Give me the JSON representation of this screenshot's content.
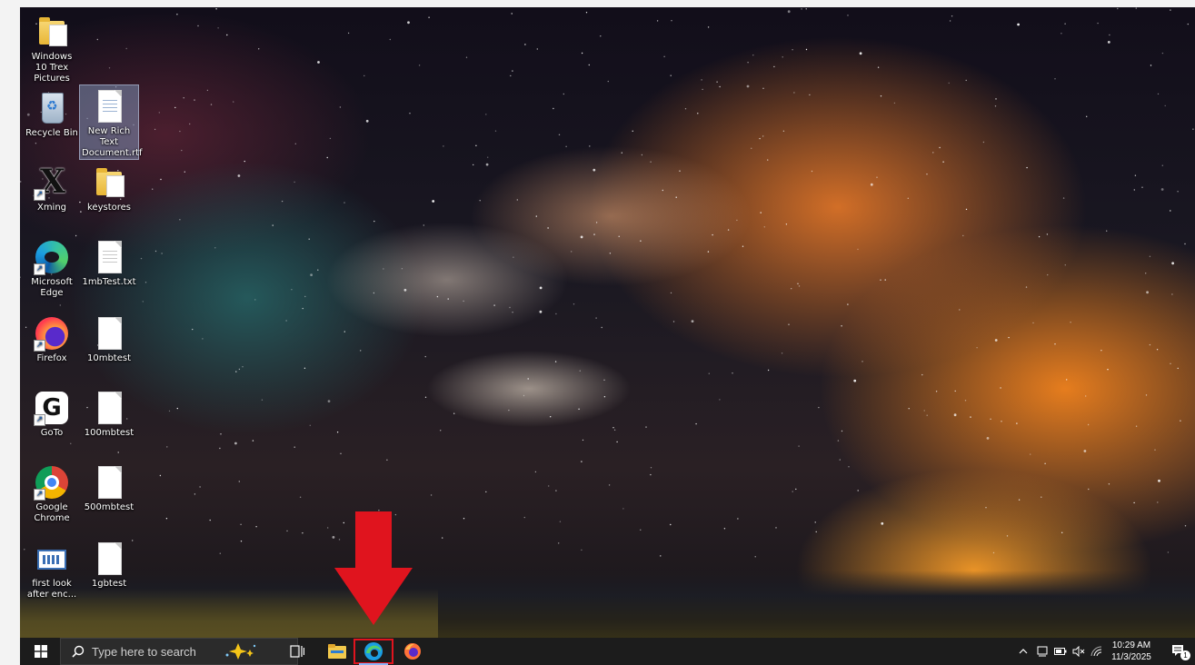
{
  "desktop": {
    "icons": [
      {
        "id": "windows-10-trex-pictures",
        "label": "Windows 10 Trex Pictures",
        "icon": "folder-icon"
      },
      {
        "id": "recycle-bin",
        "label": "Recycle Bin",
        "icon": "recycle-bin-icon"
      },
      {
        "id": "new-rich-text-document",
        "label": "New Rich Text Document.rtf",
        "icon": "rtf-document-icon"
      },
      {
        "id": "xming",
        "label": "Xming",
        "icon": "xming-icon"
      },
      {
        "id": "keystores",
        "label": "keystores",
        "icon": "folder-icon"
      },
      {
        "id": "microsoft-edge",
        "label": "Microsoft Edge",
        "icon": "edge-icon"
      },
      {
        "id": "1mbtest",
        "label": "1mbTest.txt",
        "icon": "text-file-icon"
      },
      {
        "id": "firefox",
        "label": "Firefox",
        "icon": "firefox-icon"
      },
      {
        "id": "10mbtest",
        "label": "10mbtest",
        "icon": "blank-file-icon"
      },
      {
        "id": "goto",
        "label": "GoTo",
        "icon": "goto-icon"
      },
      {
        "id": "100mbtest",
        "label": "100mbtest",
        "icon": "blank-file-icon"
      },
      {
        "id": "google-chrome",
        "label": "Google Chrome",
        "icon": "chrome-icon"
      },
      {
        "id": "500mbtest",
        "label": "500mbtest",
        "icon": "blank-file-icon"
      },
      {
        "id": "first-look",
        "label": "first look after enc...",
        "icon": "screenshot-icon"
      },
      {
        "id": "1gbtest",
        "label": "1gbtest",
        "icon": "blank-file-icon"
      }
    ]
  },
  "annotation": {
    "type": "red-arrow",
    "color": "#e0141e",
    "target": "taskbar edge button"
  },
  "taskbar": {
    "search_placeholder": "Type here to search",
    "pinned": [
      "start-icon",
      "search-icon",
      "copilot-icon",
      "task-view-icon",
      "file-explorer-icon",
      "edge-icon",
      "firefox-icon"
    ],
    "highlighted_app": "edge",
    "tray_icons": [
      "chevron-up-icon",
      "meet-now-icon",
      "battery-icon",
      "volume-muted-icon",
      "wifi-icon",
      "notification-icon"
    ],
    "time": "10:29 AM",
    "date": "11/3/2025",
    "notification_count": "1"
  },
  "colors": {
    "taskbar": "#1c1c1c",
    "highlight": "#e0141e",
    "accent": "#0078d4"
  }
}
